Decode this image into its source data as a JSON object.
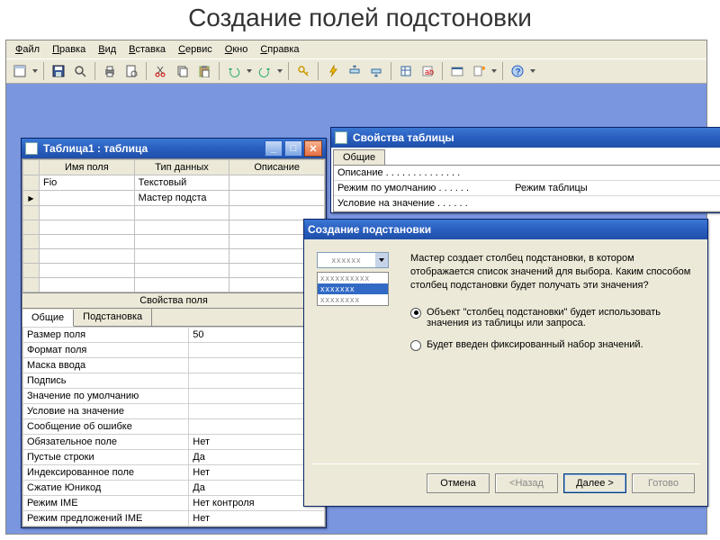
{
  "page_title": "Создание полей подстоновки",
  "menu": [
    "Файл",
    "Правка",
    "Вид",
    "Вставка",
    "Сервис",
    "Окно",
    "Справка"
  ],
  "table_window": {
    "title": "Таблица1 : таблица",
    "columns": [
      "Имя поля",
      "Тип данных",
      "Описание"
    ],
    "rows": [
      {
        "sel": false,
        "name": "Fio",
        "type": "Текстовый",
        "desc": ""
      },
      {
        "sel": true,
        "name": "",
        "type": "Мастер подста",
        "desc": ""
      }
    ],
    "blank_rows": 6,
    "section": "Свойства поля",
    "tabs": [
      "Общие",
      "Подстановка"
    ],
    "props": [
      {
        "n": "Размер поля",
        "v": "50"
      },
      {
        "n": "Формат поля",
        "v": ""
      },
      {
        "n": "Маска ввода",
        "v": ""
      },
      {
        "n": "Подпись",
        "v": ""
      },
      {
        "n": "Значение по умолчанию",
        "v": ""
      },
      {
        "n": "Условие на значение",
        "v": ""
      },
      {
        "n": "Сообщение об ошибке",
        "v": ""
      },
      {
        "n": "Обязательное поле",
        "v": "Нет"
      },
      {
        "n": "Пустые строки",
        "v": "Да"
      },
      {
        "n": "Индексированное поле",
        "v": "Нет"
      },
      {
        "n": "Сжатие Юникод",
        "v": "Да"
      },
      {
        "n": "Режим IME",
        "v": "Нет контроля"
      },
      {
        "n": "Режим предложений IME",
        "v": "Нет"
      }
    ]
  },
  "props_window": {
    "title": "Свойства таблицы",
    "tab": "Общие",
    "rows": [
      {
        "n": "Описание . . . . . . . . . . . . . .",
        "v": ""
      },
      {
        "n": "Режим по умолчанию . . . . . .",
        "v": "Режим таблицы"
      },
      {
        "n": "Условие на значение . . . . . .",
        "v": ""
      }
    ]
  },
  "wizard": {
    "title": "Создание подстановки",
    "intro": "Мастер создает столбец подстановки, в котором отображается список значений для выбора. Каким способом столбец подстановки будет получать эти значения?",
    "combo_text": "xxxxxx",
    "list": [
      "xxxxxxxxxx",
      "xxxxxxx",
      "xxxxxxxx"
    ],
    "opt1": "Объект \"столбец подстановки\" будет использовать значения из таблицы или запроса.",
    "opt2": "Будет введен фиксированный набор значений.",
    "buttons": {
      "cancel": "Отмена",
      "back": "<Назад",
      "next": "Далее >",
      "finish": "Готово"
    }
  }
}
